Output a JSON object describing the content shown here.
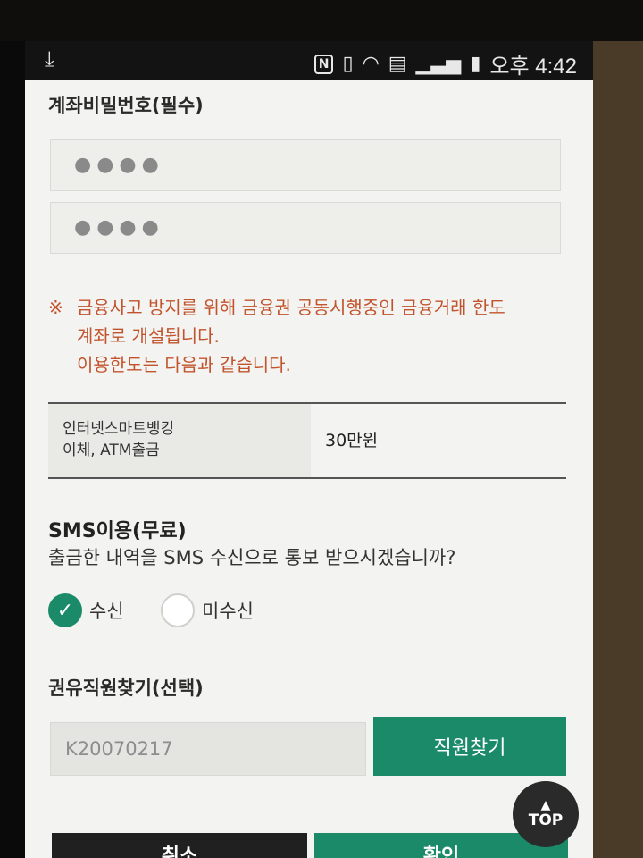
{
  "status_bar": {
    "download_icon": "download-icon",
    "time": "오후 4:42"
  },
  "password": {
    "title": "계좌비밀번호(필수)",
    "field1": "●●●●",
    "field2": "●●●●"
  },
  "notice": {
    "mark": "※",
    "line1": "금융사고 방지를 위해 금융권 공동시행중인 금융거래 한도",
    "line2": "계좌로 개설됩니다.",
    "line3": "이용한도는 다음과 같습니다."
  },
  "limit_table": {
    "label_line1": "인터넷스마트뱅킹",
    "label_line2": "이체, ATM출금",
    "value": "30만원"
  },
  "sms": {
    "title": "SMS이용(무료)",
    "question": "출금한 내역을 SMS 수신으로 통보 받으시겠습니까?",
    "option_receive": "수신",
    "option_no_receive": "미수신",
    "selected": "수신"
  },
  "recommender": {
    "title": "권유직원찾기(선택)",
    "input_value": "K20070217",
    "search_button": "직원찾기"
  },
  "bottom": {
    "cancel": "취소",
    "confirm": "확인",
    "top": "TOP"
  },
  "colors": {
    "accent": "#1b8a68",
    "notice": "#c2542d"
  }
}
